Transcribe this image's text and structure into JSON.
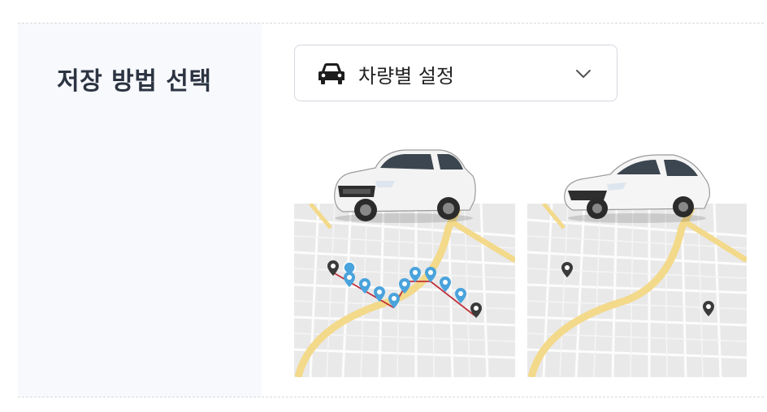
{
  "setting": {
    "label": "저장 방법 선택",
    "dropdown": {
      "icon": "car-icon",
      "selected": "차량별 설정"
    }
  },
  "options": [
    {
      "icon": "suv-car-icon",
      "map_icon": "route-map-with-many-pins-icon"
    },
    {
      "icon": "sedan-car-icon",
      "map_icon": "route-map-with-two-pins-icon"
    }
  ],
  "colors": {
    "label_bg": "#f7f9fc",
    "label_text": "#2c3442",
    "pin_blue": "#4aa3dc",
    "pin_dark": "#3a3a3a",
    "route_red": "#c0303a",
    "road_yellow": "#f3d98a"
  }
}
